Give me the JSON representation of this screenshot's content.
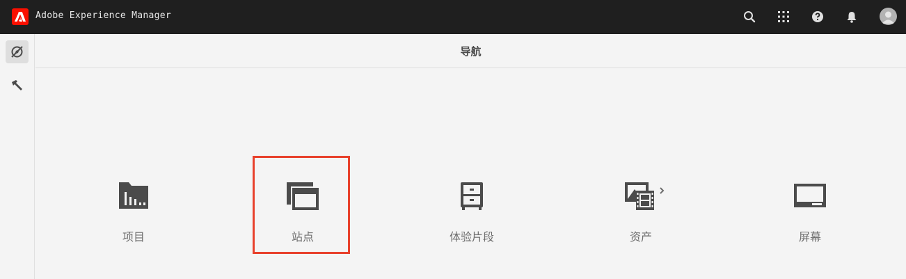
{
  "app": {
    "title": "Adobe Experience Manager",
    "logo_icon": "adobe-logo-icon",
    "brand_color": "#fa0f00"
  },
  "topbar": {
    "icons": [
      "search-icon",
      "apps-grid-icon",
      "help-icon",
      "bell-icon",
      "user-avatar"
    ]
  },
  "rail": {
    "items": [
      {
        "icon": "navigation-compass-icon",
        "active": true
      },
      {
        "icon": "tools-hammer-icon",
        "active": false
      }
    ]
  },
  "header": {
    "title": "导航"
  },
  "nav": {
    "items": [
      {
        "label": "项目",
        "icon": "projects-icon"
      },
      {
        "label": "站点",
        "icon": "sites-icon",
        "highlighted": true
      },
      {
        "label": "体验片段",
        "icon": "experience-fragments-icon"
      },
      {
        "label": "资产",
        "icon": "assets-icon",
        "has_submenu": true
      },
      {
        "label": "屏幕",
        "icon": "screens-icon"
      }
    ]
  },
  "colors": {
    "topbar_bg": "#1f1f1f",
    "page_bg": "#f4f4f4",
    "icon_color": "#4b4b4b",
    "highlight_border": "#e8412c"
  }
}
